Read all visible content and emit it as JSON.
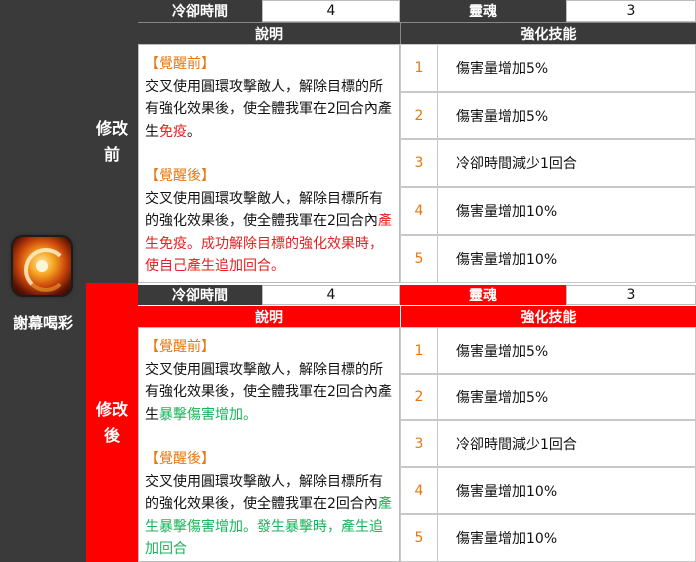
{
  "skill": {
    "name": "謝幕喝彩",
    "icon": "fire-swirl-icon"
  },
  "sections": [
    {
      "label": "修改前",
      "cooldown_label": "冷卻時間",
      "cooldown_value": "4",
      "soul_label": "靈魂",
      "soul_value": "3",
      "desc_header": "說明",
      "enh_header": "強化技能",
      "desc_before_tag": "【覺醒前】",
      "desc_before_main": "交叉使用圓環攻擊敵人，解除目標的所有強化效果後，使全體我軍在2回合內產生",
      "desc_before_hl": "免疫",
      "desc_before_end": "。",
      "desc_after_tag": "【覺醒後】",
      "desc_after_main": "交叉使用圓環攻擊敵人，解除目標所有的強化效果後，使全體我軍在2回合內",
      "desc_after_hl": "產生免疫。成功解除目標的強化效果時，使自己產生追加回合。",
      "enhancements": [
        {
          "num": "1",
          "text": "傷害量增加5%"
        },
        {
          "num": "2",
          "text": "傷害量增加5%"
        },
        {
          "num": "3",
          "text": "冷卻時間減少1回合"
        },
        {
          "num": "4",
          "text": "傷害量增加10%"
        },
        {
          "num": "5",
          "text": "傷害量增加10%"
        }
      ]
    },
    {
      "label": "修改後",
      "cooldown_label": "冷卻時間",
      "cooldown_value": "4",
      "soul_label": "靈魂",
      "soul_value": "3",
      "desc_header": "說明",
      "enh_header": "強化技能",
      "desc_before_tag": "【覺醒前】",
      "desc_before_main": "交叉使用圓環攻擊敵人，解除目標的所有強化效果後，使全體我軍在2回合內產生",
      "desc_before_hl": "暴擊傷害增加",
      "desc_before_end": "。",
      "desc_after_tag": "【覺醒後】",
      "desc_after_main": "交叉使用圓環攻擊敵人，解除目標所有的強化效果後，使全體我軍在2回合內",
      "desc_after_hl": "產生暴擊傷害增加。發生暴擊時，產生追加回合",
      "enhancements": [
        {
          "num": "1",
          "text": "傷害量增加5%"
        },
        {
          "num": "2",
          "text": "傷害量增加5%"
        },
        {
          "num": "3",
          "text": "冷卻時間減少1回合"
        },
        {
          "num": "4",
          "text": "傷害量增加10%"
        },
        {
          "num": "5",
          "text": "傷害量增加10%"
        }
      ]
    }
  ],
  "colors": {
    "before_bg": "#3a3a3a",
    "after_bg": "#ff0000",
    "number": "#e9770f",
    "highlight_before": "#e52020",
    "highlight_after": "#19b35a"
  }
}
